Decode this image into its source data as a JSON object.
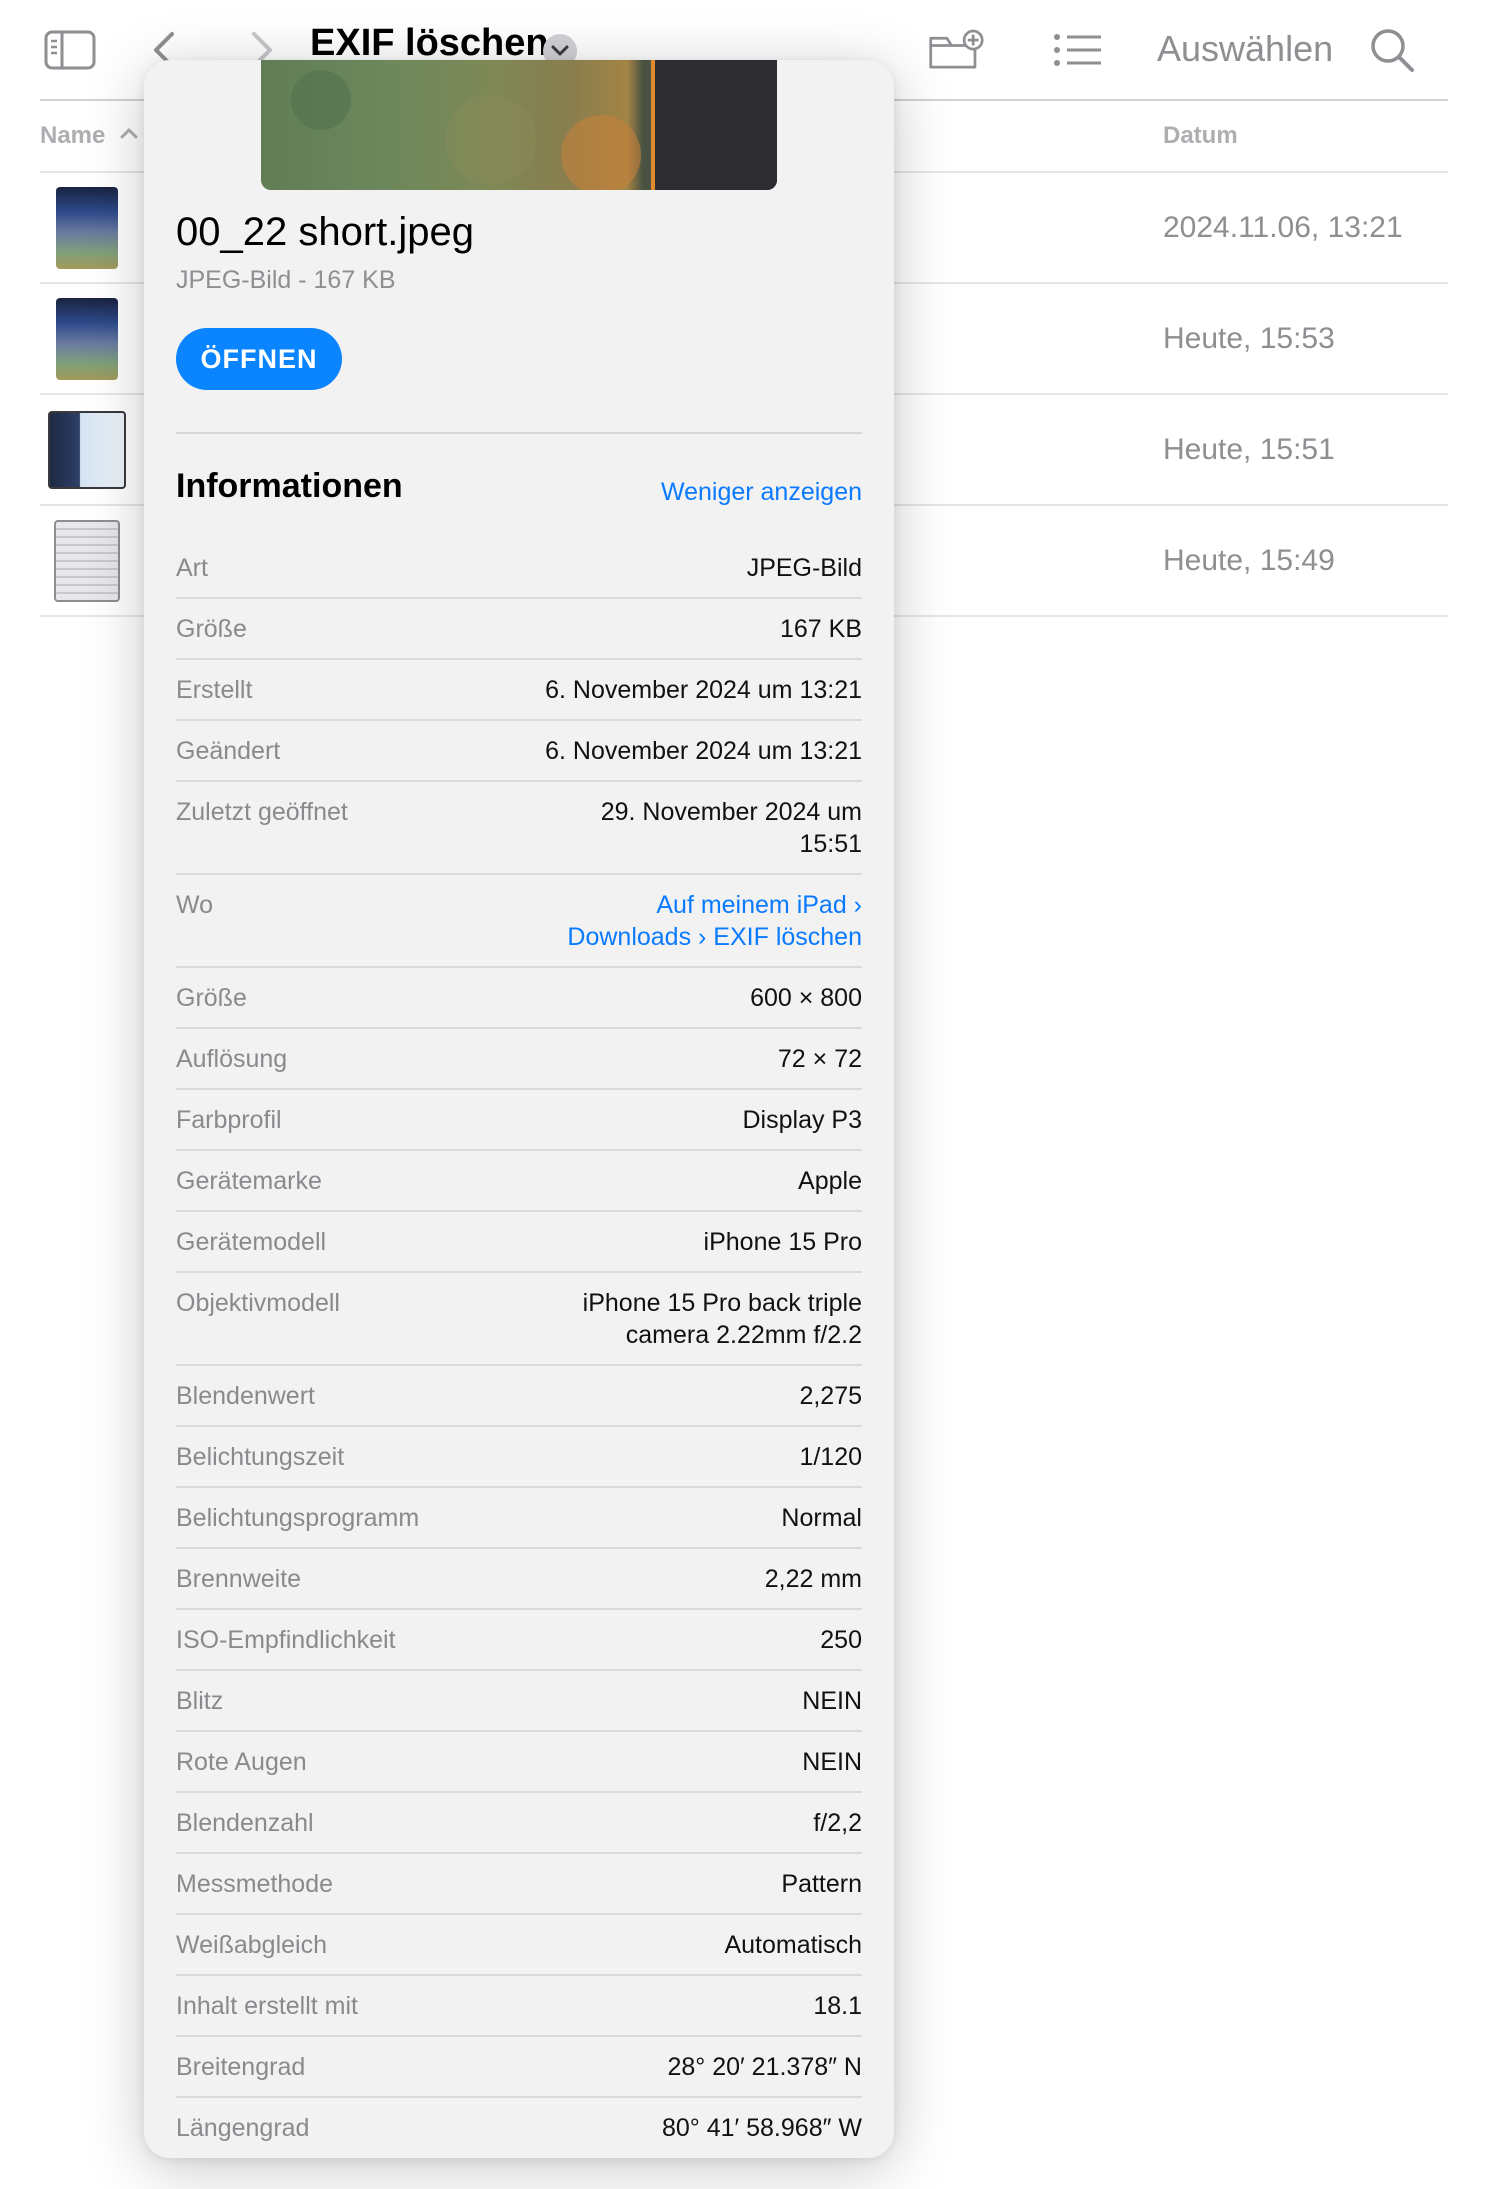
{
  "toolbar": {
    "title": "EXIF löschen",
    "select_label": "Auswählen"
  },
  "columns": {
    "name": "Name",
    "date": "Datum"
  },
  "files": [
    {
      "date": "2024.11.06, 13:21"
    },
    {
      "date": "Heute, 15:53"
    },
    {
      "date": "Heute, 15:51"
    },
    {
      "date": "Heute, 15:49"
    }
  ],
  "popover": {
    "file_name": "00_22 short.jpeg",
    "file_sub": "JPEG-Bild - 167 KB",
    "open_label": "ÖFFNEN",
    "info_title": "Informationen",
    "show_less": "Weniger anzeigen",
    "rows": [
      {
        "label": "Art",
        "value": "JPEG-Bild"
      },
      {
        "label": "Größe",
        "value": "167 KB"
      },
      {
        "label": "Erstellt",
        "value": "6. November 2024 um 13:21"
      },
      {
        "label": "Geändert",
        "value": "6. November 2024 um 13:21"
      },
      {
        "label": "Zuletzt geöffnet",
        "value": "29. November 2024 um 15:51"
      },
      {
        "label": "Wo",
        "value": "Auf meinem iPad › Downloads › EXIF löschen"
      },
      {
        "label": "Größe",
        "value": "600 × 800"
      },
      {
        "label": "Auflösung",
        "value": "72 × 72"
      },
      {
        "label": "Farbprofil",
        "value": "Display P3"
      },
      {
        "label": "Gerätemarke",
        "value": "Apple"
      },
      {
        "label": "Gerätemodell",
        "value": "iPhone 15 Pro"
      },
      {
        "label": "Objektivmodell",
        "value": "iPhone 15 Pro back triple camera 2.22mm f/2.2"
      },
      {
        "label": "Blendenwert",
        "value": "2,275"
      },
      {
        "label": "Belichtungszeit",
        "value": "1/120"
      },
      {
        "label": "Belichtungsprogramm",
        "value": "Normal"
      },
      {
        "label": "Brennweite",
        "value": "2,22 mm"
      },
      {
        "label": "ISO-Empfindlichkeit",
        "value": "250"
      },
      {
        "label": "Blitz",
        "value": "NEIN"
      },
      {
        "label": "Rote Augen",
        "value": "NEIN"
      },
      {
        "label": "Blendenzahl",
        "value": "f/2,2"
      },
      {
        "label": "Messmethode",
        "value": "Pattern"
      },
      {
        "label": "Weißabgleich",
        "value": "Automatisch"
      },
      {
        "label": "Inhalt erstellt mit",
        "value": "18.1"
      },
      {
        "label": "Breitengrad",
        "value": "28° 20′ 21.378″ N"
      },
      {
        "label": "Längengrad",
        "value": "80° 41′ 58.968″ W"
      }
    ]
  },
  "icons": [
    "sidebar-icon",
    "back-chevron-icon",
    "forward-chevron-icon",
    "title-chevron-down-icon",
    "new-folder-icon",
    "list-view-icon",
    "search-icon",
    "sort-ascending-icon"
  ]
}
